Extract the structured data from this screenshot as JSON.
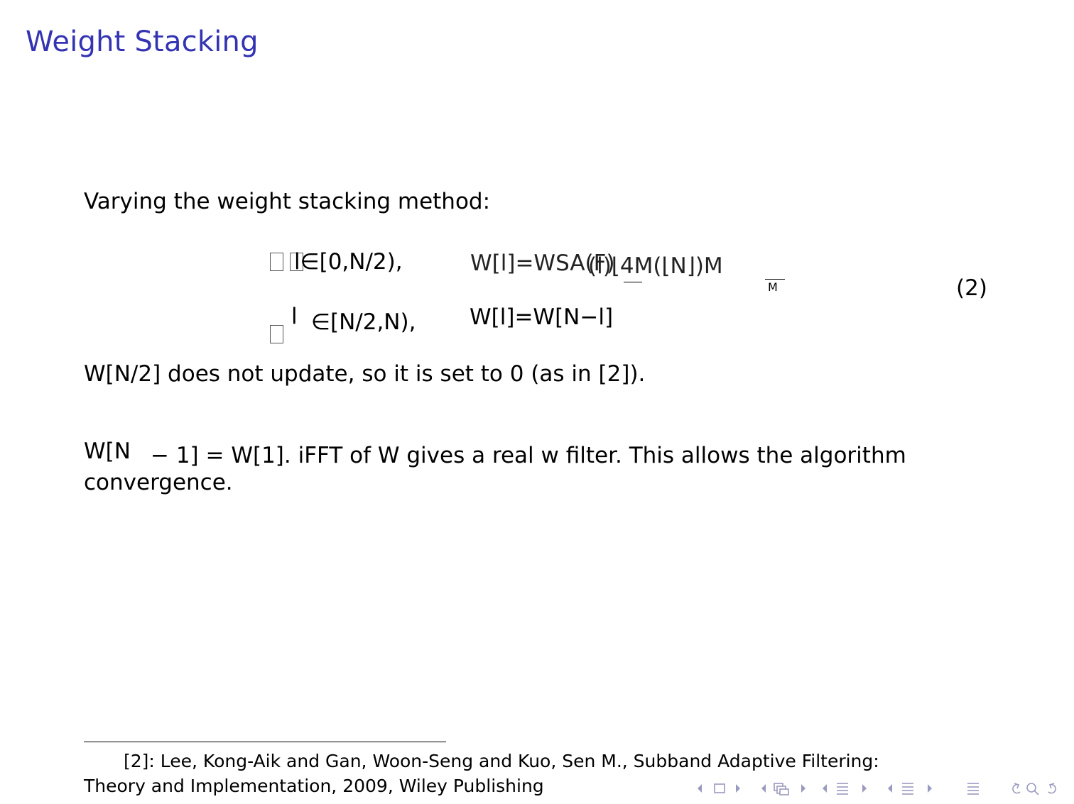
{
  "slide": {
    "title": "Weight Stacking"
  },
  "content": {
    "intro": "Varying the weight stacking method:",
    "equation": {
      "case1_condition": "l∈[0,N/2),",
      "case1_expr_a": "W[l]=WSA(F)",
      "case1_expr_b": "(l)⌊4M(⌊N⌋)M",
      "case1_frac_denominator": "M",
      "case2_var": "l",
      "case2_condition": "∈[N/2,N),",
      "case2_expr": "W[l]=W[N−l]",
      "number": "(2)"
    },
    "line_wn2": "W[N/2] does not update, so it is set to 0 (as in [2]).",
    "line_wn1_a": "W[N",
    "line_wn1_b": "− 1] = W[1]. iFFT of W gives a real w filter. This allows the algorithm",
    "line_convergence": "convergence."
  },
  "footnote": {
    "line1": "[2]: Lee, Kong-Aik and Gan, Woon-Seng and Kuo, Sen M., Subband Adaptive Filtering:",
    "line2": "Theory and Implementation, 2009, Wiley Publishing"
  },
  "navigation": {
    "icons": [
      "nav-prev-frame-icon",
      "nav-frame-icon",
      "nav-next-frame-icon",
      "nav-prev-subsection-icon",
      "nav-subsection-icon",
      "nav-next-subsection-icon",
      "nav-prev-section-icon",
      "nav-section-icon",
      "nav-next-section-icon",
      "nav-prev-doc-icon",
      "nav-doc-icon",
      "nav-next-doc-icon",
      "nav-toc-icon",
      "nav-back-icon",
      "nav-search-icon",
      "nav-forward-icon"
    ],
    "color": "#9a9ac0"
  },
  "colors": {
    "title": "#3333b3"
  }
}
